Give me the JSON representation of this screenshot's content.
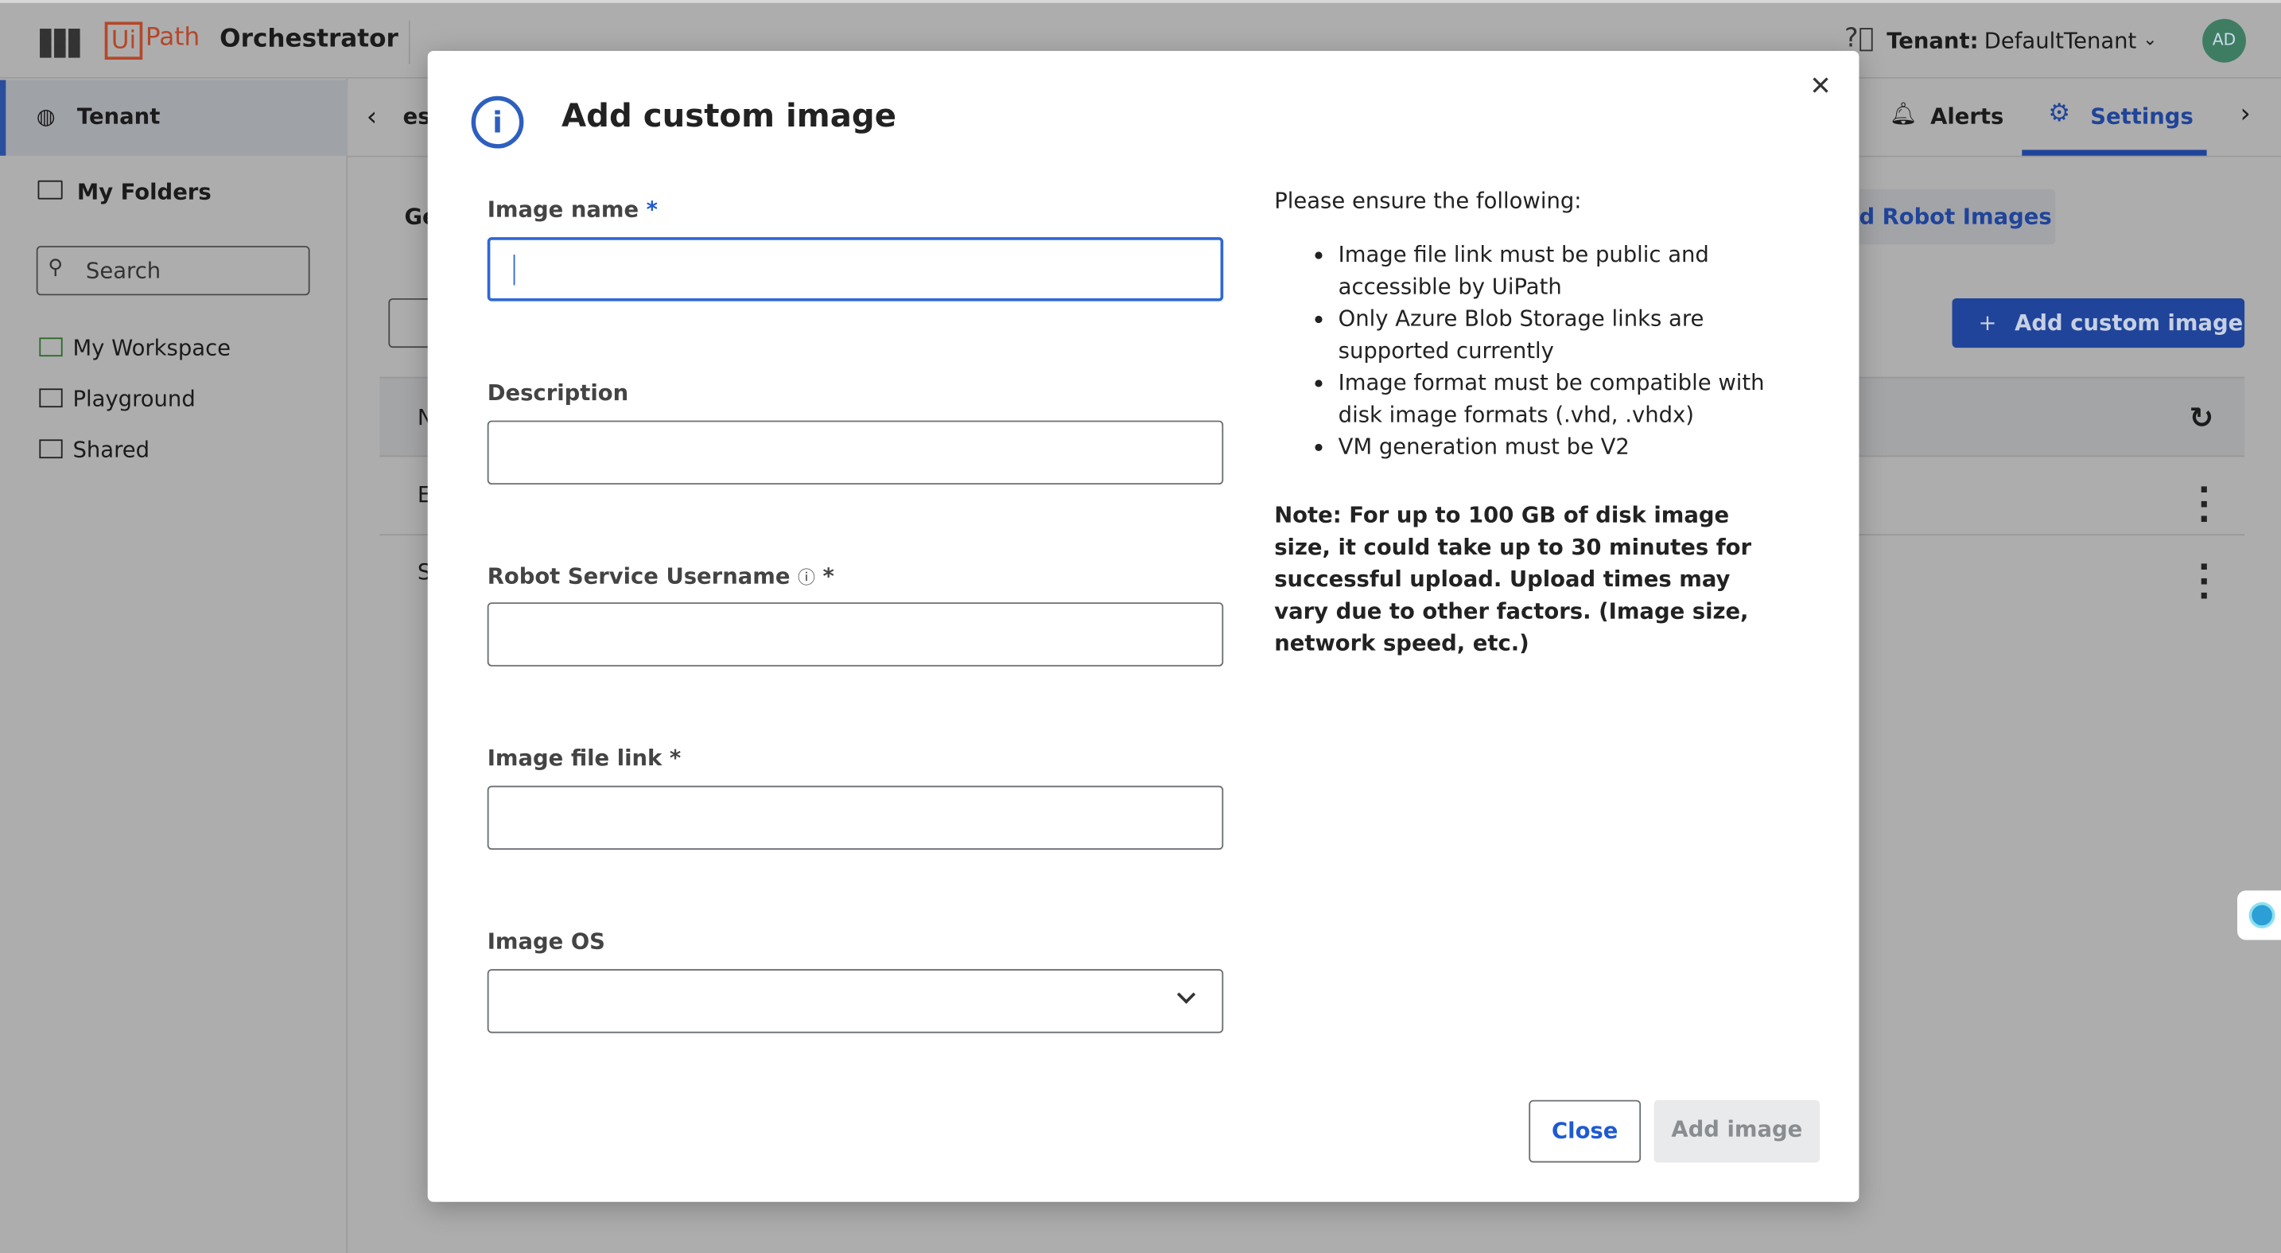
{
  "app": {
    "logo_ui": "Ui",
    "logo_path": "Path",
    "product": "Orchestrator"
  },
  "topbar": {
    "tenant_label": "Tenant:",
    "tenant_value": "DefaultTenant",
    "avatar": "AD",
    "icons": [
      "search-icon",
      "add-icon",
      "bell-icon",
      "document-icon",
      "help-icon"
    ]
  },
  "sidebar": {
    "tenant": "Tenant",
    "my_folders": "My Folders",
    "search_placeholder": "Search",
    "folders": [
      "My Workspace",
      "Playground",
      "Shared"
    ]
  },
  "background": {
    "tab_fragment": "es",
    "section_fragment": "Ge",
    "alerts": "Alerts",
    "settings": "Settings",
    "robot_images_fragment": "d Robot Images",
    "add_custom_image": "Add custom image",
    "col_fragment": "N",
    "row_fragments": [
      "E",
      "S"
    ]
  },
  "modal": {
    "title": "Add custom image",
    "fields": {
      "image_name": "Image name",
      "description": "Description",
      "robot_user": "Robot Service Username",
      "file_link": "Image file link",
      "image_os": "Image OS",
      "required_mark": "*"
    },
    "values": {
      "image_name": "",
      "description": "",
      "robot_user": "",
      "file_link": "",
      "image_os": ""
    },
    "ensure_heading": "Please ensure the following:",
    "bullets": [
      "Image file link must be public and accessible by UiPath",
      "Only Azure Blob Storage links are supported currently",
      "Image format must be compatible with disk image formats (.vhd, .vhdx)",
      "VM generation must be V2"
    ],
    "note": "Note: For up to 100 GB of disk image size, it could take up to 30 minutes for successful upload. Upload times may vary due to other factors. (Image size, network speed, etc.)",
    "close_button": "Close",
    "add_button": "Add image"
  },
  "colors": {
    "accent": "#2f68d4",
    "brand": "#b5472a",
    "primary_button": "#1f449a"
  }
}
